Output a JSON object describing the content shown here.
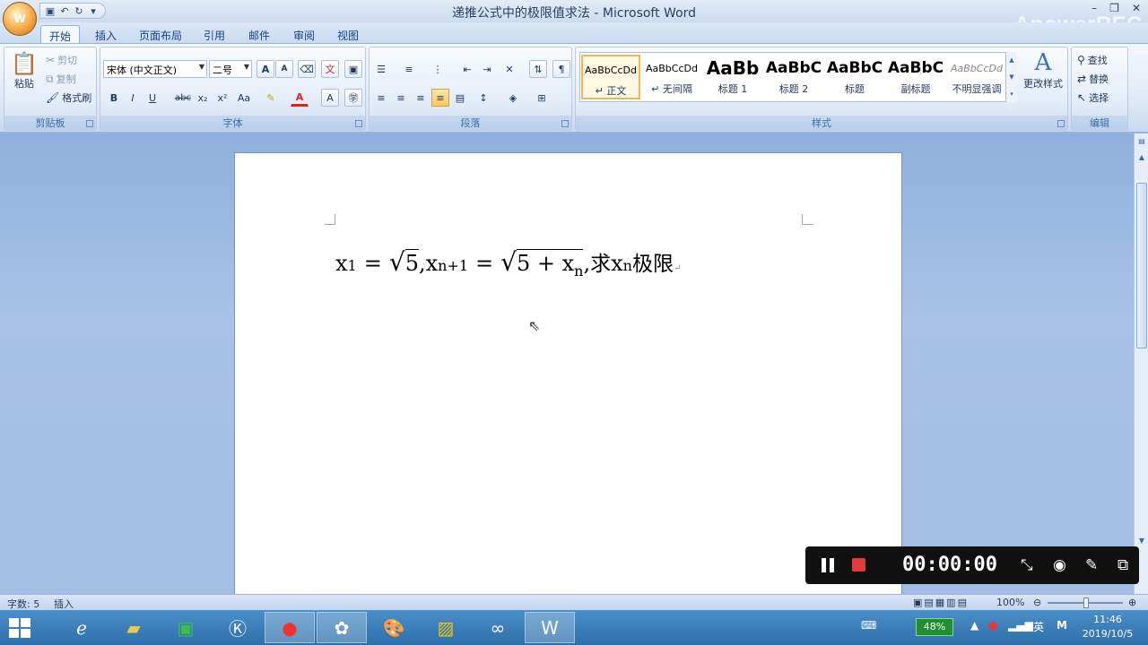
{
  "window": {
    "title": "递推公式中的极限值求法 - Microsoft Word",
    "watermark": "ApowerREC",
    "office_button_text": "W"
  },
  "tabs": [
    "开始",
    "插入",
    "页面布局",
    "引用",
    "邮件",
    "审阅",
    "视图"
  ],
  "ribbon": {
    "clipboard": {
      "paste": "粘贴",
      "cut": "剪切",
      "copy": "复制",
      "format_painter": "格式刷",
      "label": "剪贴板"
    },
    "font": {
      "font_name": "宋体 (中文正文)",
      "font_size": "二号",
      "label": "字体",
      "bold": "B",
      "italic": "I",
      "underline": "U",
      "strike": "abc",
      "subscript": "x₂",
      "superscript": "x²",
      "change_case": "Aa",
      "grow": "A",
      "shrink": "A"
    },
    "paragraph": {
      "label": "段落"
    },
    "styles": {
      "label": "样式",
      "items": [
        {
          "sample": "AaBbCcDd",
          "name": "↵ 正文"
        },
        {
          "sample": "AaBbCcDd",
          "name": "↵ 无间隔"
        },
        {
          "sample": "AaBb",
          "name": "标题 1"
        },
        {
          "sample": "AaBbC",
          "name": "标题 2"
        },
        {
          "sample": "AaBbC",
          "name": "标题"
        },
        {
          "sample": "AaBbC",
          "name": "副标题"
        },
        {
          "sample": "AaBbCcDd",
          "name": "不明显强调"
        }
      ],
      "change_styles": "更改样式"
    },
    "editing": {
      "find": "查找",
      "replace": "替换",
      "select": "选择",
      "label": "编辑"
    }
  },
  "document": {
    "formula": {
      "x": "x",
      "sub1": "1",
      "eq": "=",
      "sqrt5": "5",
      "comma": ",",
      "subn1": "n+1",
      "inner": "5 + x",
      "subn": "n",
      "ask": "求",
      "limit": "极限"
    }
  },
  "recorder": {
    "time": "00:00:00"
  },
  "statusbar": {
    "word_count": "字数: 5",
    "mode": "插入",
    "zoom": "100%"
  },
  "taskbar": {
    "battery": "48%",
    "ime": "英",
    "ime2": "M",
    "time": "11:46",
    "date": "2019/10/5"
  }
}
